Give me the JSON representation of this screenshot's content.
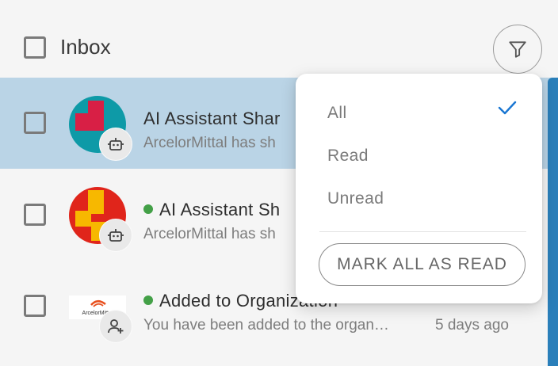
{
  "header": {
    "title": "Inbox",
    "filter_icon": "filter-icon"
  },
  "notifications": [
    {
      "title": "AI Assistant Shar",
      "subtitle": "ArcelorMittal has sh",
      "unread": false,
      "selected": true,
      "badge_icon": "robot-icon"
    },
    {
      "title": "AI Assistant Sh",
      "subtitle": "ArcelorMittal has sh",
      "unread": true,
      "selected": false,
      "badge_icon": "robot-icon"
    },
    {
      "title": "Added to Organization",
      "subtitle": "You have been added to the organ…",
      "time": "5 days ago",
      "unread": true,
      "selected": false,
      "badge_icon": "add-user-icon",
      "logo_text": "ArcelorMittal"
    }
  ],
  "filter_menu": {
    "options": [
      "All",
      "Read",
      "Unread"
    ],
    "selected": "All",
    "mark_all_label": "MARK ALL AS READ"
  },
  "colors": {
    "accent": "#1976d2",
    "selected_row": "#bad4e6",
    "unread_dot": "#43a047",
    "scrollbar": "#2a7fba"
  }
}
